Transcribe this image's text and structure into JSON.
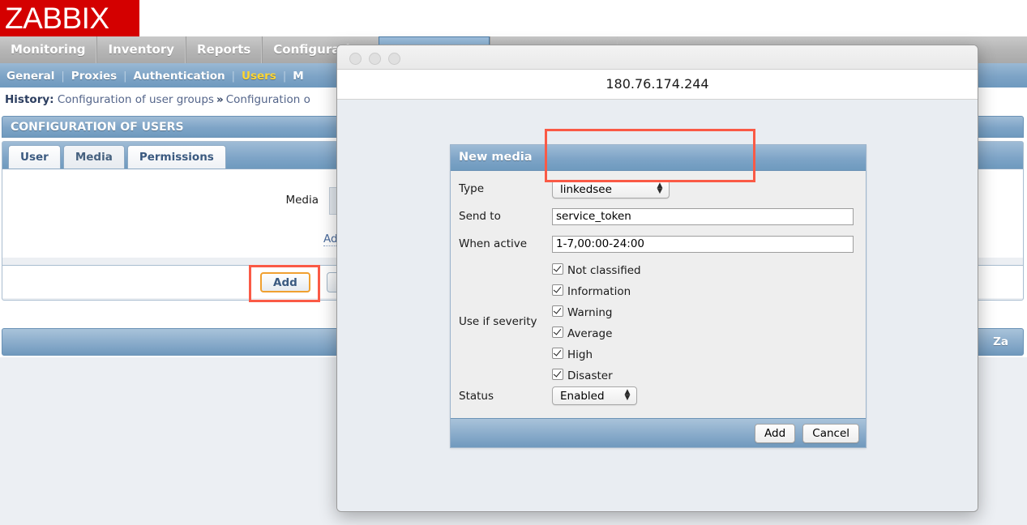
{
  "brand": {
    "logo_text": "ZABBIX",
    "logo_color": "#d40000"
  },
  "main_menu": {
    "items": [
      {
        "label": "Monitoring",
        "active": false
      },
      {
        "label": "Inventory",
        "active": false
      },
      {
        "label": "Reports",
        "active": false
      },
      {
        "label": "Configuration",
        "active": false
      }
    ]
  },
  "sub_menu": {
    "items": [
      {
        "label": "General",
        "selected": false
      },
      {
        "label": "Proxies",
        "selected": false
      },
      {
        "label": "Authentication",
        "selected": false
      },
      {
        "label": "Users",
        "selected": true
      },
      {
        "label": "M",
        "selected": false
      }
    ],
    "separator": "|"
  },
  "history": {
    "label": "History:",
    "item1": "Configuration of user groups",
    "arrow": "»",
    "item2": "Configuration o"
  },
  "page": {
    "title": "CONFIGURATION OF USERS",
    "footer_text": "Za"
  },
  "form": {
    "tabs": [
      {
        "label": "User",
        "selected": false
      },
      {
        "label": "Media",
        "selected": true
      },
      {
        "label": "Permissions",
        "selected": false
      }
    ],
    "media_label": "Media",
    "add_link": "Ad",
    "add_button": "Add"
  },
  "browser_window": {
    "url_title": "180.76.174.244",
    "traffic_lights": [
      "close-dot",
      "minimize-dot",
      "zoom-dot"
    ]
  },
  "new_media": {
    "title": "New media",
    "fields": {
      "type": {
        "label": "Type",
        "value": "linkedsee"
      },
      "send_to": {
        "label": "Send to",
        "value": "service_token",
        "placeholder": ""
      },
      "when_active": {
        "label": "When active",
        "value": "1-7,00:00-24:00",
        "placeholder": ""
      },
      "severity": {
        "label": "Use if severity"
      },
      "status": {
        "label": "Status",
        "value": "Enabled"
      }
    },
    "severities": [
      {
        "label": "Not classified",
        "checked": true
      },
      {
        "label": "Information",
        "checked": true
      },
      {
        "label": "Warning",
        "checked": true
      },
      {
        "label": "Average",
        "checked": true
      },
      {
        "label": "High",
        "checked": true
      },
      {
        "label": "Disaster",
        "checked": true
      }
    ],
    "buttons": {
      "add": "Add",
      "cancel": "Cancel"
    }
  },
  "annotations": {
    "highlight_color": "#fa5a46",
    "boxes": [
      {
        "name": "type-and-send-to-fields"
      },
      {
        "name": "add-button"
      }
    ]
  }
}
